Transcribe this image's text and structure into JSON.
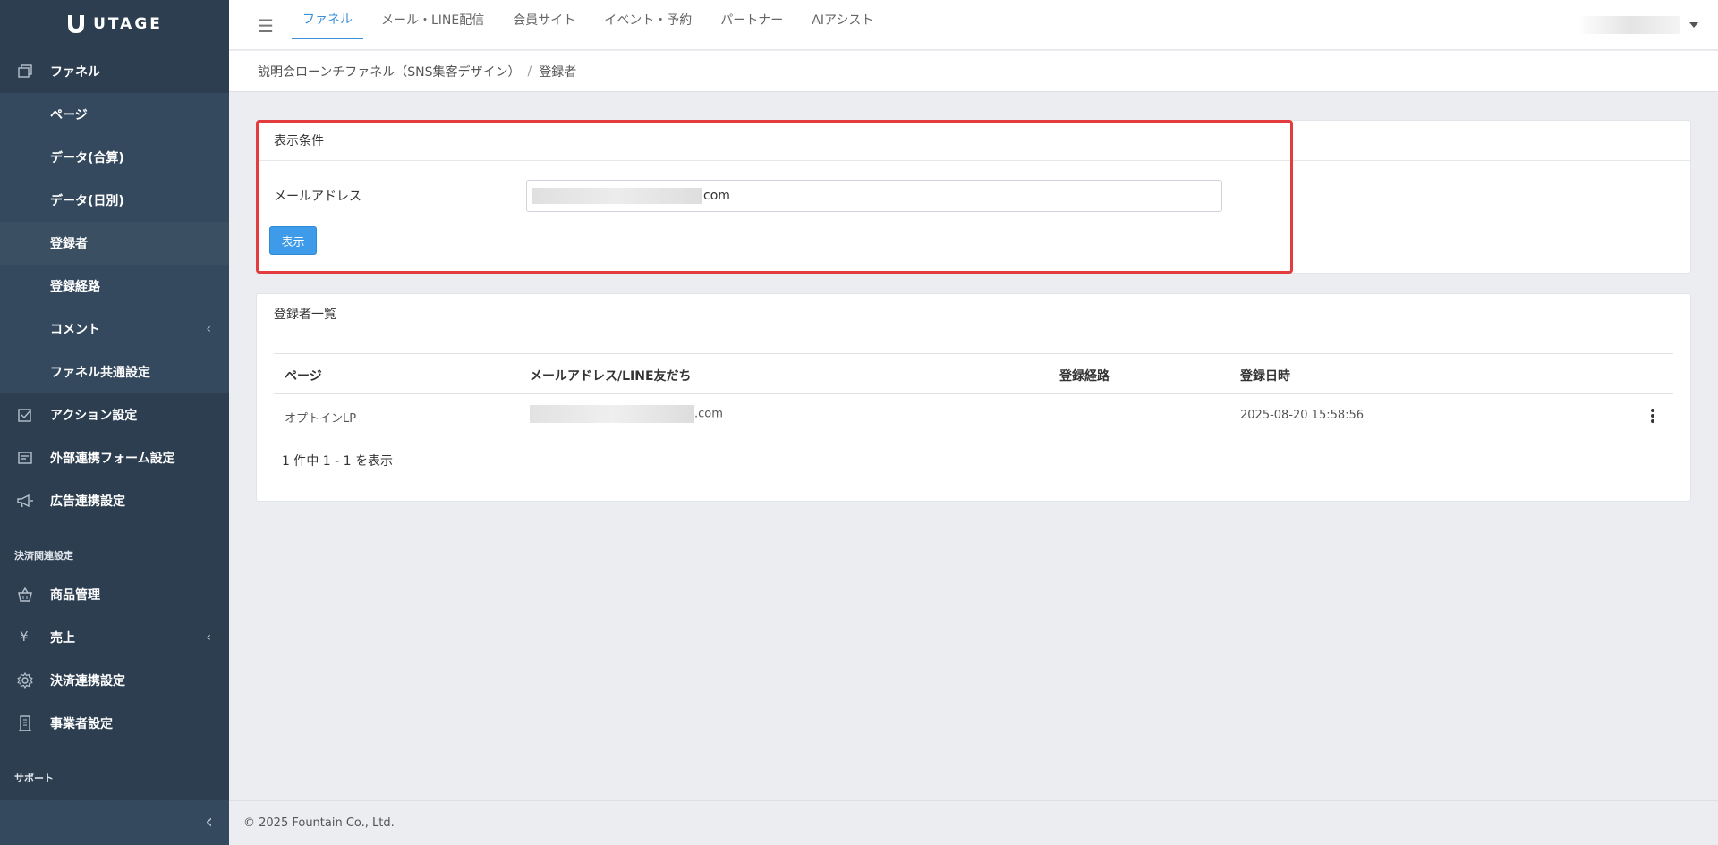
{
  "brand": {
    "name": "UTAGE"
  },
  "sidebar": {
    "items": [
      {
        "label": "ファネル",
        "icon": "copy-icon"
      },
      {
        "label": "ページ"
      },
      {
        "label": "データ(合算)"
      },
      {
        "label": "データ(日別)"
      },
      {
        "label": "登録者"
      },
      {
        "label": "登録経路"
      },
      {
        "label": "コメント",
        "chevron": "‹"
      },
      {
        "label": "ファネル共通設定"
      },
      {
        "label": "アクション設定",
        "icon": "checkbox-icon"
      },
      {
        "label": "外部連携フォーム設定",
        "icon": "form-icon"
      },
      {
        "label": "広告連携設定",
        "icon": "megaphone-icon"
      }
    ],
    "section_payment": "決済関連設定",
    "payment_items": [
      {
        "label": "商品管理",
        "icon": "basket-icon"
      },
      {
        "label": "売上",
        "icon": "yen-icon",
        "glyph": "¥",
        "chevron": "‹"
      },
      {
        "label": "決済連携設定",
        "icon": "gear-icon"
      },
      {
        "label": "事業者設定",
        "icon": "building-icon"
      }
    ],
    "section_support": "サポート",
    "collapse_glyph": "‹"
  },
  "topbar": {
    "menu_glyph": "☰",
    "tabs": [
      "ファネル",
      "メール・LINE配信",
      "会員サイト",
      "イベント・予約",
      "パートナー",
      "AIアシスト"
    ]
  },
  "breadcrumb": {
    "parent": "説明会ローンチファネル（SNS集客デザイン）",
    "separator": "/",
    "current": "登録者"
  },
  "filter_card": {
    "title": "表示条件",
    "email_label": "メールアドレス",
    "email_value_suffix": "com",
    "submit_label": "表示"
  },
  "list_card": {
    "title": "登録者一覧",
    "columns": [
      "ページ",
      "メールアドレス/LINE友だち",
      "登録経路",
      "登録日時"
    ],
    "rows": [
      {
        "page": "オプトインLP",
        "email_suffix": ".com",
        "route": "",
        "registered_at": "2025-08-20 15:58:56"
      }
    ],
    "pagination": "1 件中 1 - 1 を表示"
  },
  "footer": {
    "copyright": "© 2025 Fountain Co., Ltd."
  },
  "colors": {
    "sidebar": "#2c3e50",
    "accent": "#3d8fd8",
    "button": "#3d9be9",
    "highlight": "#e23c3f"
  }
}
